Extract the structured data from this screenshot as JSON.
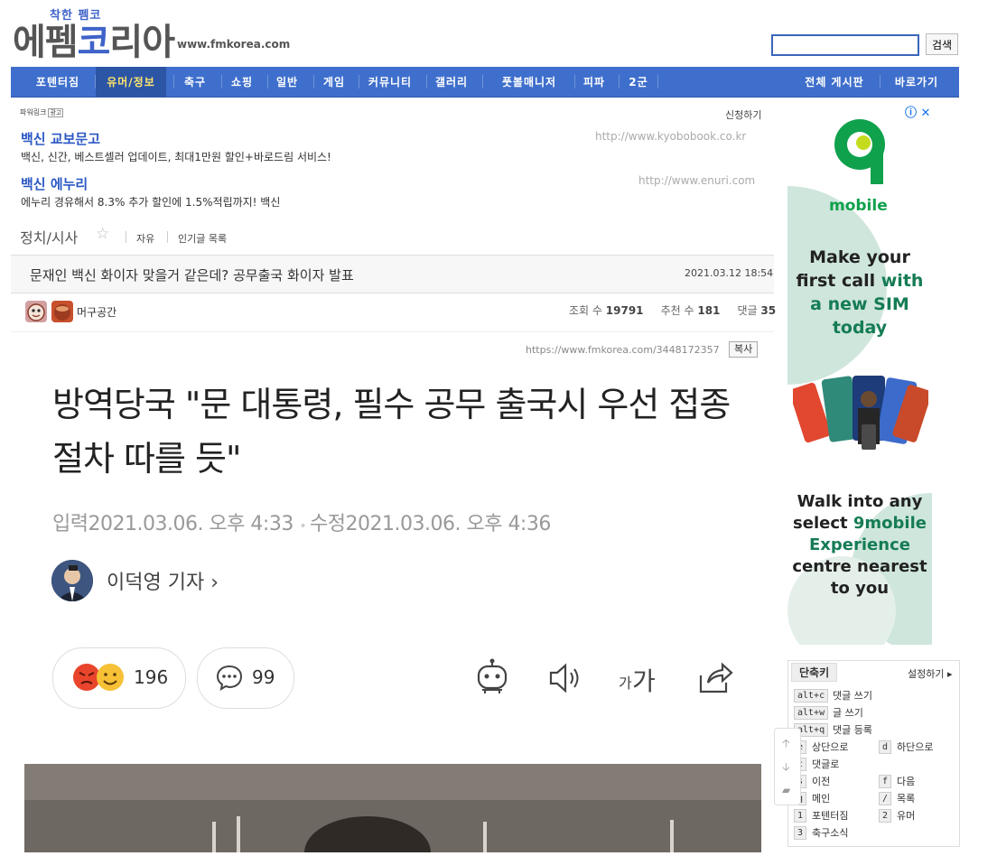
{
  "header": {
    "logo_small": "착한 펨코",
    "logo_text_1": "에펨",
    "logo_text_2": "코",
    "logo_text_3": "리아",
    "site_url": "www.fmkorea.com",
    "search_button": "검색"
  },
  "nav": {
    "items": [
      "포텐터짐",
      "유머/정보",
      "축구",
      "쇼핑",
      "일반",
      "게임",
      "커뮤니티",
      "갤러리",
      "풋볼매니저",
      "피파",
      "2군"
    ],
    "right_items": [
      "전체 게시판",
      "바로가기"
    ],
    "active": "유머/정보"
  },
  "ads": {
    "powerlink_label": "파워링크",
    "powerlink_badge": "광고",
    "apply_label": "신청하기",
    "items": [
      {
        "title": "백신 교보문고",
        "url": "http://www.kyobobook.co.kr",
        "desc": "백신, 신간, 베스트셀러 업데이트, 최대1만원 할인+바로드림 서비스!"
      },
      {
        "title": "백신 에누리",
        "url": "http://www.enuri.com",
        "desc": "에누리 경유해서 8.3% 추가 할인에 1.5%적립까지! 백신"
      }
    ]
  },
  "board": {
    "title": "정치/시사",
    "star": "☆",
    "free": "자유",
    "popular": "인기글 목록"
  },
  "post": {
    "title": "문재인 백신 화이자 맞을거 같은데? 공무출국 화이자 발표",
    "date": "2021.03.12 18:54",
    "author": "머구공간",
    "views_label": "조회 수",
    "views": "19791",
    "recommend_label": "추천 수",
    "recommend": "181",
    "comments_label": "댓글",
    "comments": "35",
    "url": "https://www.fmkorea.com/3448172357",
    "copy_label": "복사"
  },
  "article": {
    "headline": "방역당국 \"문 대통령, 필수 공무 출국시 우선 접종절차 따를 듯\"",
    "input_label": "입력",
    "input_date": "2021.03.06. 오후 4:33",
    "edit_label": "수정",
    "edit_date": "2021.03.06. 오후 4:36",
    "reporter": "이덕영 기자",
    "reporter_chevron": "›",
    "reaction_count": "196",
    "comment_count": "99",
    "font_size_label_small": "가",
    "font_size_label_large": "가"
  },
  "side_ad": {
    "brand_number": "9",
    "brand_name": "mobile",
    "text1_a": "Make your",
    "text1_b": "first call",
    "text1_c": "with",
    "text1_d": "a new SIM",
    "text1_e": "today",
    "text2_a": "Walk into any",
    "text2_b": "select",
    "text2_c": "9mobile",
    "text2_d": "Experience",
    "text2_e": "centre nearest",
    "text2_f": "to you"
  },
  "shortcuts": {
    "title": "단축키",
    "settings": "설정하기",
    "wide": [
      {
        "key": "alt+c",
        "label": "댓글 쓰기"
      },
      {
        "key": "alt+w",
        "label": "글 쓰기"
      },
      {
        "key": "alt+q",
        "label": "댓글 등록"
      }
    ],
    "grid": [
      {
        "key": "e",
        "label": "상단으로"
      },
      {
        "key": "d",
        "label": "하단으로"
      },
      {
        "key": "c",
        "label": "댓글로"
      },
      {
        "key": "s",
        "label": "이전"
      },
      {
        "key": "f",
        "label": "다음"
      },
      {
        "key": "q",
        "label": "메인"
      },
      {
        "key": "/",
        "label": "목록"
      },
      {
        "key": "1",
        "label": "포텐터짐"
      },
      {
        "key": "2",
        "label": "유머"
      },
      {
        "key": "3",
        "label": "축구소식"
      }
    ]
  },
  "colors": {
    "nav_bg": "#3f6fcc",
    "nav_active": "#2c55a6",
    "ad_title": "#2b57c4",
    "brand_green": "#157c54"
  }
}
